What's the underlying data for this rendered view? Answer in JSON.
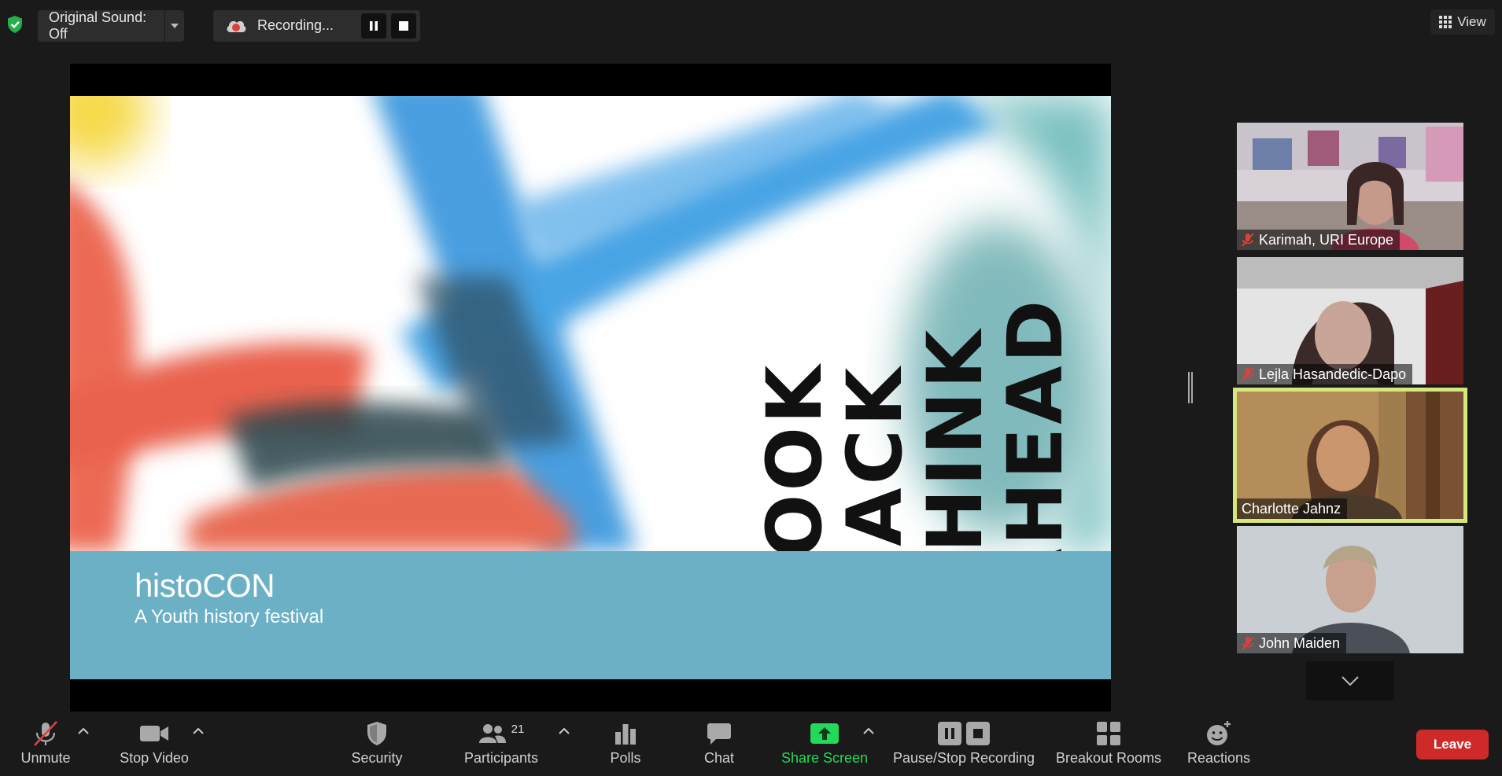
{
  "top_bar": {
    "original_sound_label": "Original Sound: Off",
    "recording_label": "Recording...",
    "view_label": "View"
  },
  "shared_screen": {
    "slide_words": [
      "LOOK",
      "BACK",
      "THINK",
      "AHEAD"
    ],
    "festival_title": "histoCON",
    "festival_subtitle": "A Youth history festival"
  },
  "participants": [
    {
      "name": "Karimah, URI Europe",
      "muted": true,
      "active": false
    },
    {
      "name": "Lejla Hasandedic-Dapo",
      "muted": true,
      "active": false
    },
    {
      "name": "Charlotte Jahnz",
      "muted": false,
      "active": true
    },
    {
      "name": "John Maiden",
      "muted": true,
      "active": false
    }
  ],
  "toolbar": {
    "unmute": "Unmute",
    "stop_video": "Stop Video",
    "security": "Security",
    "participants": "Participants",
    "participant_count": "21",
    "polls": "Polls",
    "chat": "Chat",
    "share_screen": "Share Screen",
    "pause_stop_recording": "Pause/Stop Recording",
    "breakout_rooms": "Breakout Rooms",
    "reactions": "Reactions",
    "leave": "Leave"
  },
  "colors": {
    "background": "#1a1a1a",
    "share_green": "#23d959",
    "leave_red": "#cf2a2a",
    "active_speaker": "#d6e87b",
    "footer_teal": "#6cb0c6"
  }
}
